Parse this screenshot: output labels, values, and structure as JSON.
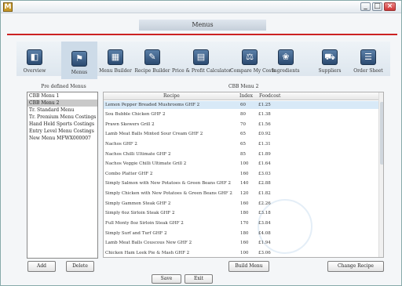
{
  "window": {
    "title": "Menus",
    "app_icon": "M",
    "controls": {
      "minimize": "_",
      "maximize": "□",
      "close": "×"
    }
  },
  "toolbar": {
    "items": [
      {
        "label": "Overview",
        "icon": "overview-icon",
        "glyph": "◧"
      },
      {
        "label": "Menus",
        "icon": "menus-icon",
        "glyph": "⚑"
      },
      {
        "label": "Menu Builder",
        "icon": "menu-builder-icon",
        "glyph": "▦"
      },
      {
        "label": "Recipe Builder",
        "icon": "recipe-builder-icon",
        "glyph": "✎"
      },
      {
        "label": "Price & Profit Calculator",
        "icon": "calculator-icon",
        "glyph": "▤"
      },
      {
        "label": "Compare My Costs",
        "icon": "compare-costs-icon",
        "glyph": "⚖"
      },
      {
        "label": "Ingredients",
        "icon": "ingredients-icon",
        "glyph": "❀"
      },
      {
        "label": "Suppliers",
        "icon": "suppliers-icon",
        "glyph": "⛟"
      },
      {
        "label": "Order Sheet",
        "icon": "order-sheet-icon",
        "glyph": "☰"
      }
    ]
  },
  "left_panel": {
    "title": "Pre defined Menus",
    "items": [
      "CBB Menu 1",
      "CBB Menu 2",
      "Tr. Standard Menu",
      "Tr. Premium Menu Costings",
      "Hand Held Sports Costings",
      "Entry Level Menu Costings",
      "New Menu MFWX000007"
    ],
    "selected_index": 1,
    "add_label": "Add",
    "delete_label": "Delete"
  },
  "right_panel": {
    "title": "CBB Menu 2",
    "columns": {
      "recipe": "Recipe",
      "index": "Index",
      "foodcost": "Foodcost"
    },
    "rows": [
      {
        "recipe": "Lemon Pepper Breaded Mushrooms GHF 2",
        "index": "60",
        "foodcost": "£1.25"
      },
      {
        "recipe": "Sou Bubble Chicken GHF 2",
        "index": "80",
        "foodcost": "£1.38"
      },
      {
        "recipe": "Prawn Skewers Grill 2",
        "index": "70",
        "foodcost": "£1.56"
      },
      {
        "recipe": "Lamb Meat Balls Minted Sour Cream GHF 2",
        "index": "65",
        "foodcost": "£0.92"
      },
      {
        "recipe": "Nachos GHF 2",
        "index": "65",
        "foodcost": "£1.31"
      },
      {
        "recipe": "Nachos Chilli Ultimate GHF 2",
        "index": "85",
        "foodcost": "£1.89"
      },
      {
        "recipe": "Nachos Veggie Chilli Ultimate Grill 2",
        "index": "100",
        "foodcost": "£1.64"
      },
      {
        "recipe": "Combo Platter GHF 2",
        "index": "160",
        "foodcost": "£3.03"
      },
      {
        "recipe": "Simply Salmon with New Potatoes & Green Beans GHF 2",
        "index": "140",
        "foodcost": "£2.88"
      },
      {
        "recipe": "Simply Chicken with New Potatoes & Green Beans GHF 2",
        "index": "120",
        "foodcost": "£1.82"
      },
      {
        "recipe": "Simply Gammon Steak GHF 2",
        "index": "160",
        "foodcost": "£2.26"
      },
      {
        "recipe": "Simply 6oz Sirloin Steak GHF 2",
        "index": "180",
        "foodcost": "£3.18"
      },
      {
        "recipe": "Full Monty 8oz Sirloin Steak GHF 2",
        "index": "170",
        "foodcost": "£3.84"
      },
      {
        "recipe": "Simply Surf and Turf GHF 2",
        "index": "180",
        "foodcost": "£4.08"
      },
      {
        "recipe": "Lamb Meat Balls Couscous New GHF 2",
        "index": "160",
        "foodcost": "£1.94"
      },
      {
        "recipe": "Chicken Ham Leek Pie & Mash GHF 2",
        "index": "100",
        "foodcost": "£3.06"
      }
    ],
    "selected_index": 0,
    "build_menu_label": "Build Menu",
    "change_recipe_label": "Change Recipe"
  },
  "footer": {
    "save_label": "Save",
    "exit_label": "Exit"
  }
}
